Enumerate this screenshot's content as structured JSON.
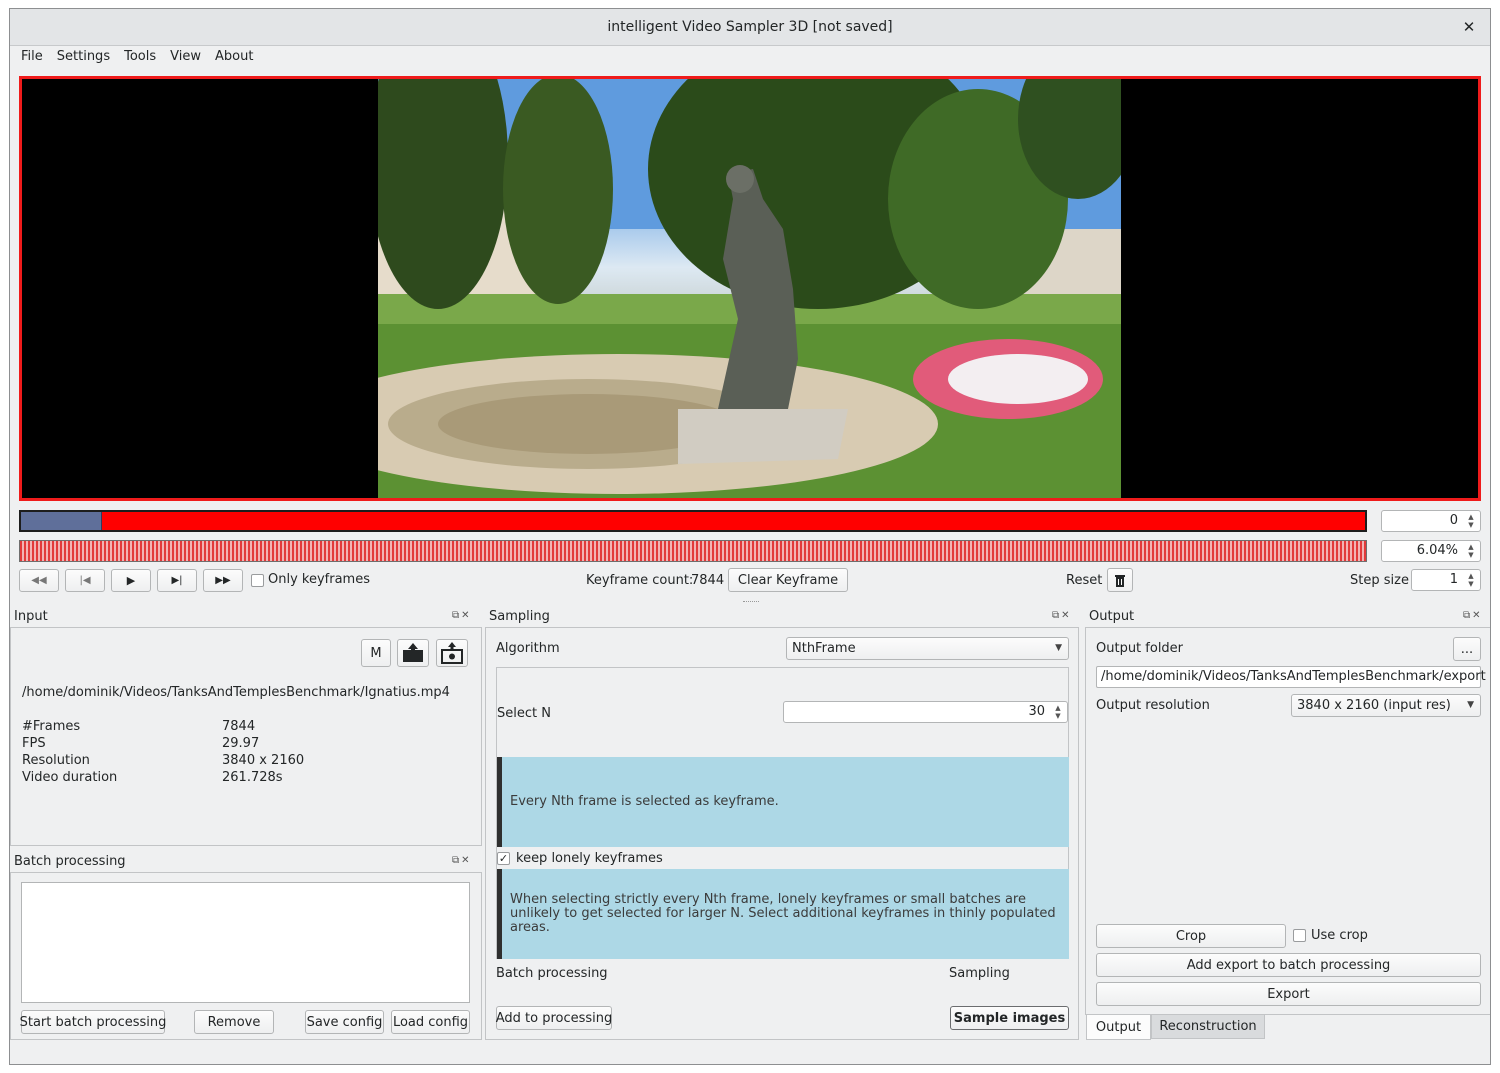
{
  "window": {
    "title": "intelligent Video Sampler 3D [not saved]"
  },
  "menu": [
    "File",
    "Settings",
    "Tools",
    "View",
    "About"
  ],
  "timeline": {
    "frame_value": "0",
    "zoom_value": "6.04%",
    "progress_fraction": 0.06
  },
  "controls": {
    "only_keyframes": "Only keyframes",
    "keyframe_count_label": "Keyframe count:",
    "keyframe_count": "7844",
    "clear_keyframe": "Clear Keyframe",
    "reset": "Reset",
    "step_size_label": "Step size",
    "step_size_value": "1"
  },
  "input_panel": {
    "title": "Input",
    "m_button": "M",
    "path": "/home/dominik/Videos/TanksAndTemplesBenchmark/Ignatius.mp4",
    "info": [
      {
        "key": "#Frames",
        "value": "7844"
      },
      {
        "key": "FPS",
        "value": "29.97"
      },
      {
        "key": "Resolution",
        "value": "3840 x 2160"
      },
      {
        "key": "Video duration",
        "value": "261.728s"
      }
    ]
  },
  "batch_panel": {
    "title": "Batch processing",
    "start": "Start batch processing",
    "remove": "Remove",
    "save": "Save config",
    "load": "Load config"
  },
  "sampling_panel": {
    "title": "Sampling",
    "algorithm_label": "Algorithm",
    "algorithm_value": "NthFrame",
    "select_n_label": "Select N",
    "select_n_value": "30",
    "info1": "Every Nth frame is selected as keyframe.",
    "keep_lonely": "keep lonely keyframes",
    "info2": "When selecting strictly every Nth frame, lonely keyframes or small batches are unlikely to get selected for larger N. Select additional keyframes in thinly populated areas.",
    "batch_label": "Batch processing",
    "sampling_label": "Sampling",
    "add_to_processing": "Add to processing",
    "sample_images": "Sample images"
  },
  "output_panel": {
    "title": "Output",
    "folder_label": "Output folder",
    "browse": "...",
    "folder_value": "/home/dominik/Videos/TanksAndTemplesBenchmark/export",
    "resolution_label": "Output resolution",
    "resolution_value": "3840 x 2160 (input res)",
    "crop": "Crop",
    "use_crop": "Use crop",
    "add_export": "Add export to batch processing",
    "export": "Export",
    "tabs": [
      "Output",
      "Reconstruction"
    ]
  },
  "colors": {
    "accent_red": "#ef1b1b",
    "info_blue": "#add8e6",
    "window_bg": "#eff0f1"
  }
}
